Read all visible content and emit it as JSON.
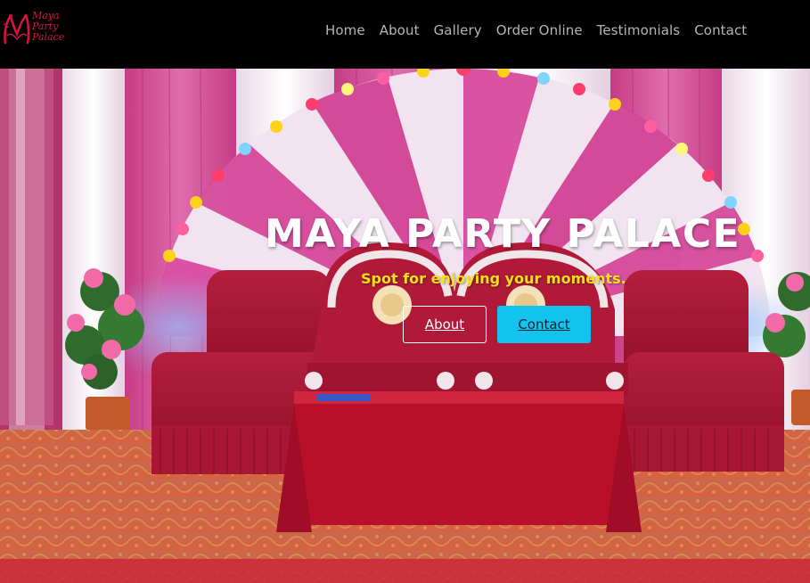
{
  "brand": {
    "logo_lines": [
      "Maya",
      "Party",
      "Palace"
    ],
    "logo_color": "#d4143a"
  },
  "nav": {
    "items": [
      {
        "label": "Home"
      },
      {
        "label": "About"
      },
      {
        "label": "Gallery"
      },
      {
        "label": "Order Online"
      },
      {
        "label": "Testimonials"
      },
      {
        "label": "Contact"
      }
    ]
  },
  "hero": {
    "title": "MAYA PARTY PALACE",
    "subtitle": "Spot for enjoying your moments.",
    "about_button": "About",
    "contact_button": "Contact",
    "accent_color": "#12c3ee",
    "subtitle_color": "#f7e01c"
  }
}
